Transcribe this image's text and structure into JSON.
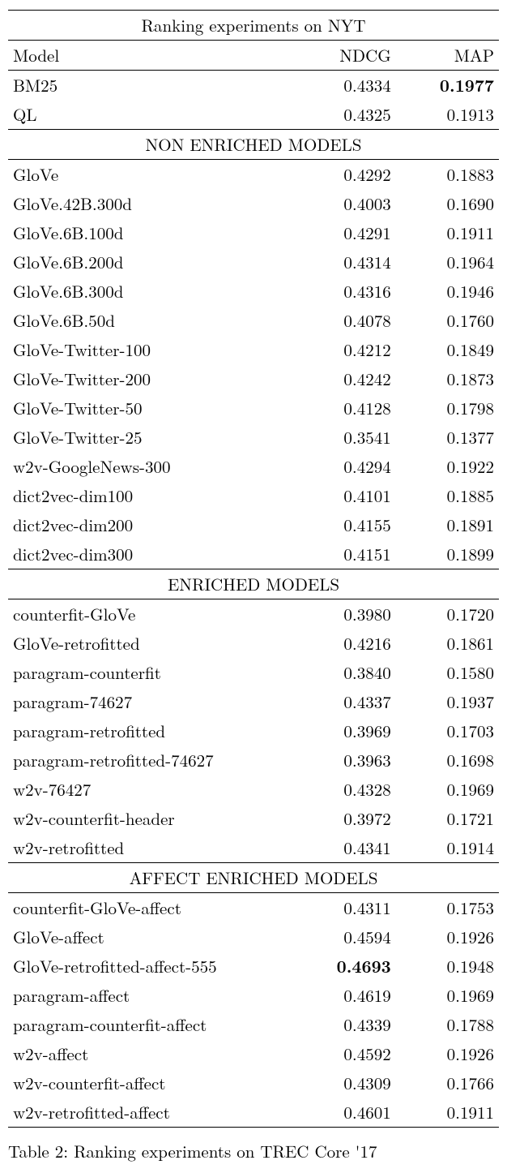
{
  "title": "Ranking experiments on NYT",
  "col_headers": {
    "model": "Model",
    "ndcg": "NDCG",
    "map": "MAP"
  },
  "baselines": [
    {
      "model": "BM25",
      "ndcg": "0.4334",
      "map": "0.1977",
      "bold_map": true
    },
    {
      "model": "QL",
      "ndcg": "0.4325",
      "map": "0.1913"
    }
  ],
  "sections": [
    {
      "header": "NON ENRICHED MODELS",
      "rows": [
        {
          "model": "GloVe",
          "ndcg": "0.4292",
          "map": "0.1883"
        },
        {
          "model": "GloVe.42B.300d",
          "ndcg": "0.4003",
          "map": "0.1690"
        },
        {
          "model": "GloVe.6B.100d",
          "ndcg": "0.4291",
          "map": "0.1911"
        },
        {
          "model": "GloVe.6B.200d",
          "ndcg": "0.4314",
          "map": "0.1964"
        },
        {
          "model": "GloVe.6B.300d",
          "ndcg": "0.4316",
          "map": "0.1946"
        },
        {
          "model": "GloVe.6B.50d",
          "ndcg": "0.4078",
          "map": "0.1760"
        },
        {
          "model": "GloVe-Twitter-100",
          "ndcg": "0.4212",
          "map": "0.1849"
        },
        {
          "model": "GloVe-Twitter-200",
          "ndcg": "0.4242",
          "map": "0.1873"
        },
        {
          "model": "GloVe-Twitter-50",
          "ndcg": "0.4128",
          "map": "0.1798"
        },
        {
          "model": "GloVe-Twitter-25",
          "ndcg": "0.3541",
          "map": "0.1377"
        },
        {
          "model": "w2v-GoogleNews-300",
          "ndcg": "0.4294",
          "map": "0.1922"
        },
        {
          "model": "dict2vec-dim100",
          "ndcg": "0.4101",
          "map": "0.1885"
        },
        {
          "model": "dict2vec-dim200",
          "ndcg": "0.4155",
          "map": "0.1891"
        },
        {
          "model": "dict2vec-dim300",
          "ndcg": "0.4151",
          "map": "0.1899"
        }
      ]
    },
    {
      "header": "ENRICHED MODELS",
      "rows": [
        {
          "model": "counterfit-GloVe",
          "ndcg": "0.3980",
          "map": "0.1720"
        },
        {
          "model": "GloVe-retrofitted",
          "ndcg": "0.4216",
          "map": "0.1861"
        },
        {
          "model": "paragram-counterfit",
          "ndcg": "0.3840",
          "map": "0.1580"
        },
        {
          "model": "paragram-74627",
          "ndcg": "0.4337",
          "map": "0.1937"
        },
        {
          "model": "paragram-retrofitted",
          "ndcg": "0.3969",
          "map": "0.1703"
        },
        {
          "model": "paragram-retrofitted-74627",
          "ndcg": "0.3963",
          "map": "0.1698"
        },
        {
          "model": "w2v-76427",
          "ndcg": "0.4328",
          "map": "0.1969"
        },
        {
          "model": "w2v-counterfit-header",
          "ndcg": "0.3972",
          "map": "0.1721"
        },
        {
          "model": "w2v-retrofitted",
          "ndcg": "0.4341",
          "map": "0.1914"
        }
      ]
    },
    {
      "header": "AFFECT ENRICHED MODELS",
      "rows": [
        {
          "model": "counterfit-GloVe-affect",
          "ndcg": "0.4311",
          "map": "0.1753"
        },
        {
          "model": "GloVe-affect",
          "ndcg": "0.4594",
          "map": "0.1926"
        },
        {
          "model": "GloVe-retrofitted-affect-555",
          "ndcg": "0.4693",
          "map": "0.1948",
          "bold_ndcg": true
        },
        {
          "model": "paragram-affect",
          "ndcg": "0.4619",
          "map": "0.1969"
        },
        {
          "model": "paragram-counterfit-affect",
          "ndcg": "0.4339",
          "map": "0.1788"
        },
        {
          "model": "w2v-affect",
          "ndcg": "0.4592",
          "map": "0.1926"
        },
        {
          "model": "w2v-counterfit-affect",
          "ndcg": "0.4309",
          "map": "0.1766"
        },
        {
          "model": "w2v-retrofitted-affect",
          "ndcg": "0.4601",
          "map": "0.1911"
        }
      ]
    }
  ],
  "caption_prefix": "Table 2: Ranking experiments on TREC Core '17"
}
